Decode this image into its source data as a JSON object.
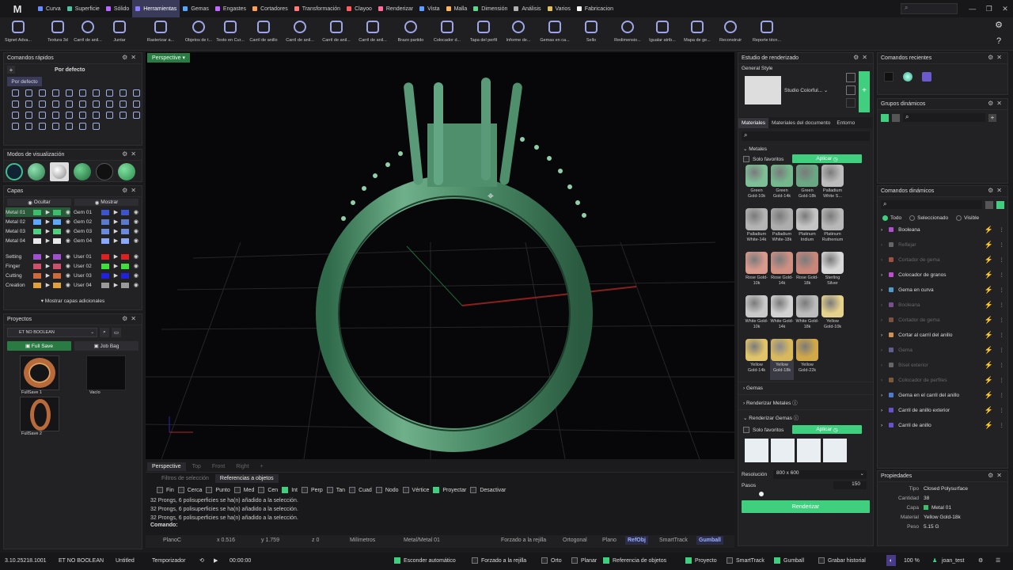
{
  "app": {
    "logo": "M"
  },
  "menu": [
    {
      "label": "Curva",
      "color": "#6b8cff"
    },
    {
      "label": "Superficie",
      "color": "#4fc3a1"
    },
    {
      "label": "Sólido",
      "color": "#b46bff"
    },
    {
      "label": "Herramientas",
      "color": "#8c7cff",
      "active": true
    },
    {
      "label": "Gemas",
      "color": "#53a7ff"
    },
    {
      "label": "Engastes",
      "color": "#c06bff"
    },
    {
      "label": "Cortadores",
      "color": "#ff9d5c"
    },
    {
      "label": "Transformación",
      "color": "#ff7a7a"
    },
    {
      "label": "Clayoo",
      "color": "#ff5f5f"
    },
    {
      "label": "Renderizar",
      "color": "#ff6f9a"
    },
    {
      "label": "Vista",
      "color": "#5f9dff"
    },
    {
      "label": "Malla",
      "color": "#ffb55f"
    },
    {
      "label": "Dimensión",
      "color": "#5fd48f"
    },
    {
      "label": "Análisis",
      "color": "#b0b0b0"
    },
    {
      "label": "Varios",
      "color": "#e0c060"
    },
    {
      "label": "Fabricacion",
      "color": "#ffffff"
    }
  ],
  "menu_search_icon": "⌕",
  "toolbar": [
    "Signet Adva...",
    "Textura 3d",
    "Carril de anil...",
    "Juntar",
    "Rasterizar a...",
    "Objetos de t...",
    "Texto en Cur...",
    "Carril de anillo",
    "Carril de anil...",
    "Carril de anil...",
    "Carril de anil...",
    "Brazo partido",
    "Colocador d...",
    "Tapa del perfil",
    "Informe de...",
    "Gemas en ca...",
    "Sello",
    "Redimensio...",
    "Igualar atrib...",
    "Mapa de ge...",
    "Reconstruir",
    "Reporte técn..."
  ],
  "quick": {
    "title": "Comandos rápidos",
    "default_label": "Por defecto",
    "tab": "Por defecto"
  },
  "display": {
    "title": "Modos de visualización"
  },
  "layers": {
    "title": "Capas",
    "hide": "Ocultar",
    "show": "Mostrar",
    "left": [
      {
        "name": "Metal 01",
        "color": "#3bbf6a",
        "selected": true
      },
      {
        "name": "Metal 02",
        "color": "#5aa9ff"
      },
      {
        "name": "Metal 03",
        "color": "#4fd07f"
      },
      {
        "name": "Metal 04",
        "color": "#e8e8e8"
      },
      {
        "name": "Setting",
        "color": "#a04fd0"
      },
      {
        "name": "Finger",
        "color": "#d04f6a"
      },
      {
        "name": "Cutting",
        "color": "#d06a3b"
      },
      {
        "name": "Creation",
        "color": "#e0a03b"
      }
    ],
    "right": [
      {
        "name": "Gem 01",
        "color": "#3b55d0"
      },
      {
        "name": "Gem 02",
        "color": "#5a7ad0"
      },
      {
        "name": "Gem 03",
        "color": "#6a8ae0"
      },
      {
        "name": "Gem 04",
        "color": "#8aa8ff"
      },
      {
        "name": "User 01",
        "color": "#e02020"
      },
      {
        "name": "User 02",
        "color": "#3be03b"
      },
      {
        "name": "User 03",
        "color": "#2020e0"
      },
      {
        "name": "User 04",
        "color": "#9a9a9a"
      }
    ],
    "more": "Mostrar capas adicionales"
  },
  "projects": {
    "title": "Proyectos",
    "current": "ET NO BOOLEAN",
    "full_save": "Full Save",
    "job_bag": "Job Bag",
    "items": [
      "FullSave 1",
      "Vacío",
      "FullSave 2"
    ]
  },
  "viewport": {
    "label": "Perspective",
    "tabs": [
      "Perspective",
      "Top",
      "Front",
      "Right",
      "+"
    ]
  },
  "command": {
    "filter_tabs": [
      "Filtros de selección",
      "Referencias a objetos"
    ],
    "snaps": [
      {
        "label": "Fin",
        "on": false
      },
      {
        "label": "Cerca",
        "on": false
      },
      {
        "label": "Punto",
        "on": false
      },
      {
        "label": "Med",
        "on": false
      },
      {
        "label": "Cen",
        "on": false
      },
      {
        "label": "Int",
        "on": true
      },
      {
        "label": "Perp",
        "on": false
      },
      {
        "label": "Tan",
        "on": false
      },
      {
        "label": "Cuad",
        "on": false
      },
      {
        "label": "Nodo",
        "on": false
      },
      {
        "label": "Vértice",
        "on": false
      },
      {
        "label": "Proyectar",
        "on": true
      },
      {
        "label": "Desactivar",
        "on": false
      }
    ],
    "history": [
      "32 Prongs, 6 polisuperficies se ha(n) añadido a la selección.",
      "32 Prongs, 6 polisuperficies se ha(n) añadido a la selección.",
      "32 Prongs, 6 polisuperficies se ha(n) añadido a la selección."
    ],
    "prompt": "Comando:"
  },
  "coordbar": {
    "plane": "PlanoC",
    "x": "x 0.516",
    "y": "y 1.759",
    "z": "z 0",
    "units": "Milímetros",
    "layer": "Metal/Metal 01",
    "buttons": [
      "Forzado a la rejilla",
      "Ortogonal",
      "Plano",
      "RefObj",
      "SmartTrack",
      "Gumball"
    ]
  },
  "render": {
    "title": "Estudio de renderizado",
    "style": "General Style",
    "studio": "Studio Colorful...",
    "tabs": [
      "Materiales",
      "Materiales del documento",
      "Entorno"
    ],
    "metals_section": "Metales",
    "only_fav": "Solo favoritos",
    "apply": "Aplicar",
    "materials": [
      {
        "name": "Green Gold-10k",
        "color": "#7fbf97"
      },
      {
        "name": "Green Gold-14k",
        "color": "#74b88d"
      },
      {
        "name": "Green Gold-18k",
        "color": "#6aa884"
      },
      {
        "name": "Palladium White S...",
        "color": "#bdbdbd"
      },
      {
        "name": "Palladium White-14k",
        "color": "#b4b4b4"
      },
      {
        "name": "Palladium White-18k",
        "color": "#adadad"
      },
      {
        "name": "Platinum Iridium",
        "color": "#c4c4c4"
      },
      {
        "name": "Platinum Ruthenium",
        "color": "#b8b8b8"
      },
      {
        "name": "Rose Gold-10k",
        "color": "#d89a8c"
      },
      {
        "name": "Rose Gold-14k",
        "color": "#cf9082"
      },
      {
        "name": "Rose Gold-18k",
        "color": "#c8877a"
      },
      {
        "name": "Sterling Silver",
        "color": "#d8d8d8"
      },
      {
        "name": "White Gold-10k",
        "color": "#c9c9c9"
      },
      {
        "name": "White Gold-14k",
        "color": "#d2d2d2"
      },
      {
        "name": "White Gold-18k",
        "color": "#bcbcbc"
      },
      {
        "name": "Yellow Gold-10k",
        "color": "#e6d28a"
      },
      {
        "name": "Yellow Gold-14k",
        "color": "#e0c46a"
      },
      {
        "name": "Yellow Gold-18k",
        "color": "#d9b95c"
      },
      {
        "name": "Yellow Gold-22k",
        "color": "#d0a848"
      }
    ],
    "gems": "Gemas",
    "render_metals": "Renderizar Metales",
    "render_gems": "Renderizar Gemas",
    "gems_fav": "Solo favoritos",
    "gems_apply": "Aplicar",
    "resolution_label": "Resolución",
    "resolution": "800 x 600",
    "steps_label": "Pasos",
    "steps": "150",
    "render_btn": "Renderizar"
  },
  "recent": {
    "title": "Comandos recientes"
  },
  "groups": {
    "title": "Grupos dinámicos"
  },
  "dynamic": {
    "title": "Comandos dinámicos",
    "filters": [
      "Todo",
      "Seleccionado",
      "Visible"
    ],
    "items": [
      {
        "label": "Booleana",
        "color": "#b04fd0",
        "enabled": true
      },
      {
        "label": "Reflejar",
        "color": "#666",
        "enabled": false
      },
      {
        "label": "Cortador de gema",
        "color": "#a05040",
        "enabled": false
      },
      {
        "label": "Colocador de granos",
        "color": "#c04fd0",
        "enabled": true
      },
      {
        "label": "Gema en curva",
        "color": "#4f9ad0",
        "enabled": true
      },
      {
        "label": "Booleana",
        "color": "#7a4f90",
        "enabled": false
      },
      {
        "label": "Cortador de gema",
        "color": "#7a5040",
        "enabled": false
      },
      {
        "label": "Cortar al carril del anillo",
        "color": "#d0904f",
        "enabled": true
      },
      {
        "label": "Gema",
        "color": "#5f5f8f",
        "enabled": false
      },
      {
        "label": "Bisel exterior",
        "color": "#666",
        "enabled": false
      },
      {
        "label": "Colocador de perfiles",
        "color": "#7a5a3a",
        "enabled": false
      },
      {
        "label": "Gema en el carril del anillo",
        "color": "#4f7ad0",
        "enabled": true
      },
      {
        "label": "Carril de anillo exterior",
        "color": "#6a4fd0",
        "enabled": true
      },
      {
        "label": "Carril de anillo",
        "color": "#6a4fd0",
        "enabled": true
      }
    ]
  },
  "properties": {
    "title": "Propiedades",
    "rows": [
      {
        "k": "Tipo",
        "v": "Closed Polysurface"
      },
      {
        "k": "Cantidad",
        "v": "38"
      },
      {
        "k": "Capa",
        "v": "Metal 01"
      },
      {
        "k": "Material",
        "v": "Yellow Gold-18k"
      },
      {
        "k": "Peso",
        "v": "5.15 G"
      }
    ]
  },
  "status": {
    "version": "3.10.25218.1001",
    "project": "ET NO BOOLEAN",
    "doc": "Untitled",
    "timer_label": "Temporizador",
    "time": "00:00:00",
    "toggles": [
      {
        "label": "Esconder automático",
        "on": true
      },
      {
        "label": "Forzado a la rejilla",
        "on": false
      },
      {
        "label": "Orto",
        "on": false
      },
      {
        "label": "Planar",
        "on": false
      },
      {
        "label": "Referencia de objetos",
        "on": true
      },
      {
        "label": "Proyecto",
        "on": true
      },
      {
        "label": "SmartTrack",
        "on": false
      },
      {
        "label": "Gumball",
        "on": true
      },
      {
        "label": "Grabar historial",
        "on": false
      }
    ],
    "zoom": "100 %",
    "user": "joan_test"
  }
}
